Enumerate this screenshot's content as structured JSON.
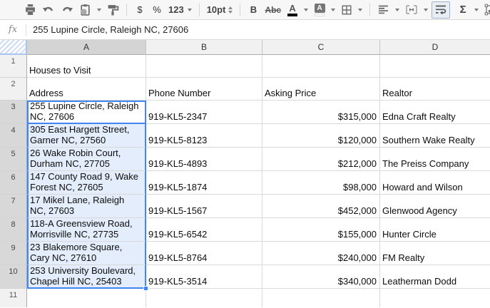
{
  "toolbar": {
    "labels": {
      "currency": "$",
      "percent": "%",
      "number_format": "123",
      "font_size": "10pt",
      "bold": "B",
      "strikethrough": "Abc",
      "text_color": "A",
      "fill_color": "A",
      "functions": "Σ"
    },
    "icons": [
      "printer-icon",
      "undo-icon",
      "redo-icon",
      "clipboard-paste-icon",
      "paint-format-icon",
      "borders-icon",
      "align-left-icon",
      "merge-cells-icon",
      "wrap-text-icon",
      "insert-chart-icon",
      "filter-icon"
    ],
    "pressed_button": "wrap-text"
  },
  "formula_bar": {
    "fx_label": "fx",
    "value": "255 Lupine Circle, Raleigh NC, 27606"
  },
  "grid": {
    "column_headers": [
      "A",
      "B",
      "C",
      "D"
    ],
    "selected_column": "A",
    "row1_number": "1",
    "row2_number": "2",
    "row11_number": "11",
    "title_cell": "Houses to Visit",
    "header_cells": {
      "address": "Address",
      "phone": "Phone Number",
      "price": "Asking Price",
      "realtor": "Realtor"
    },
    "rows": [
      {
        "n": 3,
        "address": "255 Lupine Circle, Raleigh NC, 27606",
        "phone": "919-KL5-2347",
        "price": "$315,000",
        "realtor": "Edna Craft Realty"
      },
      {
        "n": 4,
        "address": "305 East Hargett Street, Garner NC, 27560",
        "phone": "919-KL5-8123",
        "price": "$120,000",
        "realtor": "Southern Wake Realty"
      },
      {
        "n": 5,
        "address": "26 Wake Robin Court, Durham NC, 27705",
        "phone": "919-KL5-4893",
        "price": "$212,000",
        "realtor": "The Preiss Company"
      },
      {
        "n": 6,
        "address": "147 County Road 9, Wake Forest NC, 27605",
        "phone": "919-KL5-1874",
        "price": "$98,000",
        "realtor": "Howard and Wilson"
      },
      {
        "n": 7,
        "address": "17 Mikel Lane, Raleigh NC, 27603",
        "phone": "919-KL5-1567",
        "price": "$452,000",
        "realtor": "Glenwood Agency"
      },
      {
        "n": 8,
        "address": "118-A Greensview Road, Morrisville NC, 27735",
        "phone": "919-KL5-6542",
        "price": "$155,000",
        "realtor": "Hunter Circle"
      },
      {
        "n": 9,
        "address": "23 Blakemore Square, Cary NC, 27610",
        "phone": "919-KL5-8764",
        "price": "$240,000",
        "realtor": "FM Realty"
      },
      {
        "n": 10,
        "address": "253 University Boulevard, Chapel Hill NC, 25403",
        "phone": "919-KL5-3514",
        "price": "$340,000",
        "realtor": "Leatherman Dodd"
      }
    ]
  },
  "selection": {
    "range": "A3:A10",
    "active_cell": "A3"
  },
  "colors": {
    "selection_blue": "#4285f4",
    "range_fill": "#e4edfb",
    "selected_header_gray": "#d6d6d6",
    "toolbar_icon_gray": "#666666"
  }
}
